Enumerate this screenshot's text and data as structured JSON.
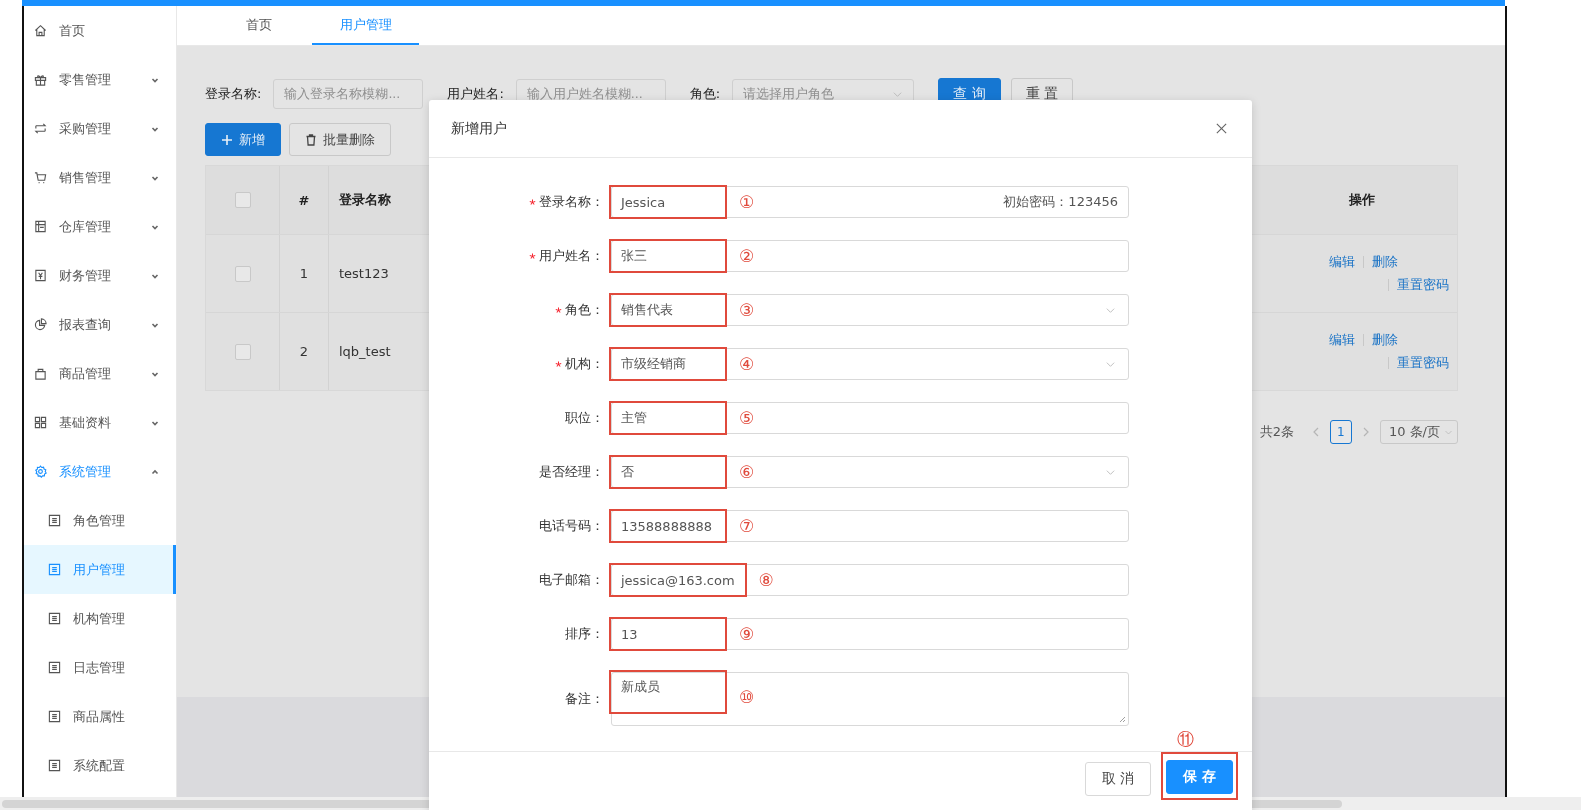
{
  "sidebar": {
    "items": [
      {
        "label": "首页",
        "selected": false
      },
      {
        "label": "零售管理",
        "selected": false,
        "expanded": false
      },
      {
        "label": "采购管理",
        "selected": false,
        "expanded": false
      },
      {
        "label": "销售管理",
        "selected": false,
        "expanded": false
      },
      {
        "label": "仓库管理",
        "selected": false,
        "expanded": false
      },
      {
        "label": "财务管理",
        "selected": false,
        "expanded": false
      },
      {
        "label": "报表查询",
        "selected": false,
        "expanded": false
      },
      {
        "label": "商品管理",
        "selected": false,
        "expanded": false
      },
      {
        "label": "基础资料",
        "selected": false,
        "expanded": false
      },
      {
        "label": "系统管理",
        "selected": false,
        "expanded": true,
        "children": [
          {
            "label": "角色管理",
            "selected": false
          },
          {
            "label": "用户管理",
            "selected": true
          },
          {
            "label": "机构管理",
            "selected": false
          },
          {
            "label": "日志管理",
            "selected": false
          },
          {
            "label": "商品属性",
            "selected": false
          },
          {
            "label": "系统配置",
            "selected": false
          }
        ]
      }
    ]
  },
  "tabs": [
    {
      "label": "首页",
      "selected": false
    },
    {
      "label": "用户管理",
      "selected": true
    }
  ],
  "query": {
    "fields": [
      {
        "label": "登录名称:",
        "placeholder": "输入登录名称模糊...",
        "kind": "input"
      },
      {
        "label": "用户姓名:",
        "placeholder": "输入用户姓名模糊...",
        "kind": "input"
      },
      {
        "label": "角色:",
        "placeholder": "请选择用户角色",
        "kind": "select"
      }
    ],
    "buttons": [
      {
        "label": "查 询",
        "kind": "primary"
      },
      {
        "label": "重 置",
        "kind": "default"
      }
    ]
  },
  "toolbar": [
    {
      "label": "新增",
      "kind": "add"
    },
    {
      "label": "批量删除",
      "kind": "delete"
    }
  ],
  "table": {
    "header_checked": false,
    "columns": [
      "#",
      "登录名称",
      "操作"
    ],
    "rows": [
      {
        "checked": false,
        "index": "1",
        "login": "test123",
        "actions": [
          "编辑",
          "删除",
          "重置密码"
        ]
      },
      {
        "checked": false,
        "index": "2",
        "login": "lqb_test",
        "actions": [
          "编辑",
          "删除",
          "重置密码"
        ]
      }
    ]
  },
  "pagination": {
    "total": "共2条",
    "pages": [
      {
        "label": "1",
        "selected": true
      }
    ],
    "page_size": "10 条/页"
  },
  "dialog": {
    "title": "新增用户",
    "fields": [
      {
        "label": "登录名称：",
        "required": true,
        "kind": "input",
        "value": "Jessica",
        "suffix": "初始密码：123456",
        "annotation": "①"
      },
      {
        "label": "用户姓名：",
        "required": true,
        "kind": "input",
        "value": "张三",
        "annotation": "②"
      },
      {
        "label": "角色：",
        "required": true,
        "kind": "select",
        "value": "销售代表",
        "annotation": "③"
      },
      {
        "label": "机构：",
        "required": true,
        "kind": "select",
        "value": "市级经销商",
        "annotation": "④"
      },
      {
        "label": "职位：",
        "required": false,
        "kind": "input",
        "value": "主管",
        "annotation": "⑤"
      },
      {
        "label": "是否经理：",
        "required": false,
        "kind": "select",
        "value": "否",
        "annotation": "⑥"
      },
      {
        "label": "电话号码：",
        "required": false,
        "kind": "input",
        "value": "13588888888",
        "annotation": "⑦"
      },
      {
        "label": "电子邮箱：",
        "required": false,
        "kind": "input",
        "value": "jessica@163.com",
        "annotation": "⑧"
      },
      {
        "label": "排序：",
        "required": false,
        "kind": "input",
        "value": "13",
        "annotation": "⑨"
      },
      {
        "label": "备注：",
        "required": false,
        "kind": "textarea",
        "value": "新成员",
        "annotation": "⑩"
      }
    ],
    "buttons": [
      {
        "label": "取 消",
        "kind": "default"
      },
      {
        "label": "保 存",
        "kind": "primary",
        "annotation": "⑪"
      }
    ]
  }
}
